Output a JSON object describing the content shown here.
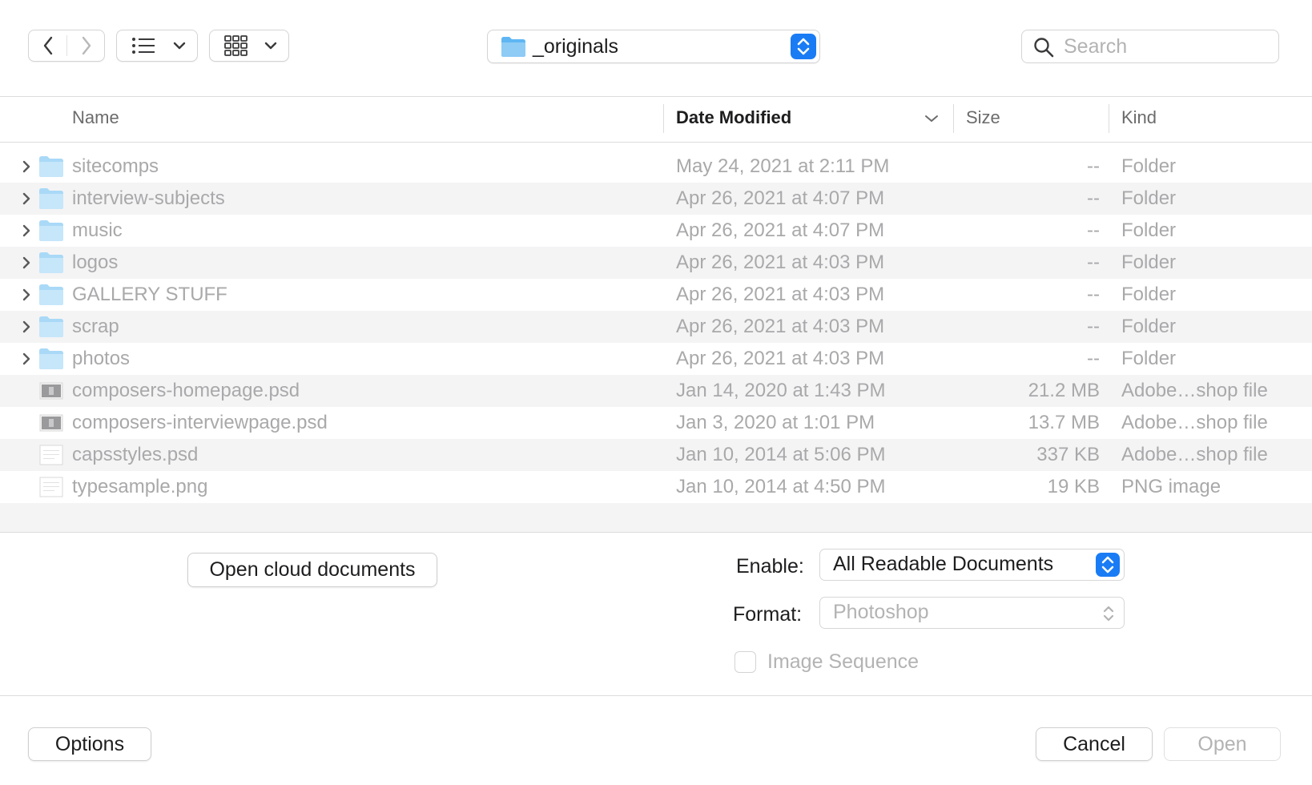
{
  "toolbar": {
    "path_popup_label": "_originals",
    "search_placeholder": "Search"
  },
  "columns": {
    "name": "Name",
    "date": "Date Modified",
    "size": "Size",
    "kind": "Kind"
  },
  "files": [
    {
      "name": "sitecomps",
      "date": "May 24, 2021 at 2:11 PM",
      "size": "--",
      "kind": "Folder",
      "type": "folder"
    },
    {
      "name": "interview-subjects",
      "date": "Apr 26, 2021 at 4:07 PM",
      "size": "--",
      "kind": "Folder",
      "type": "folder"
    },
    {
      "name": "music",
      "date": "Apr 26, 2021 at 4:07 PM",
      "size": "--",
      "kind": "Folder",
      "type": "folder"
    },
    {
      "name": "logos",
      "date": "Apr 26, 2021 at 4:03 PM",
      "size": "--",
      "kind": "Folder",
      "type": "folder"
    },
    {
      "name": "GALLERY STUFF",
      "date": "Apr 26, 2021 at 4:03 PM",
      "size": "--",
      "kind": "Folder",
      "type": "folder"
    },
    {
      "name": "scrap",
      "date": "Apr 26, 2021 at 4:03 PM",
      "size": "--",
      "kind": "Folder",
      "type": "folder"
    },
    {
      "name": "photos",
      "date": "Apr 26, 2021 at 4:03 PM",
      "size": "--",
      "kind": "Folder",
      "type": "folder"
    },
    {
      "name": "composers-homepage.psd",
      "date": "Jan 14, 2020 at 1:43 PM",
      "size": "21.2 MB",
      "kind": "Adobe…shop file",
      "type": "psd-thumb"
    },
    {
      "name": "composers-interviewpage.psd",
      "date": "Jan 3, 2020 at 1:01 PM",
      "size": "13.7 MB",
      "kind": "Adobe…shop file",
      "type": "psd-thumb"
    },
    {
      "name": "capsstyles.psd",
      "date": "Jan 10, 2014 at 5:06 PM",
      "size": "337 KB",
      "kind": "Adobe…shop file",
      "type": "doc"
    },
    {
      "name": "typesample.png",
      "date": "Jan 10, 2014 at 4:50 PM",
      "size": "19 KB",
      "kind": "PNG image",
      "type": "doc"
    }
  ],
  "footer": {
    "cloud_button": "Open cloud documents",
    "enable_label": "Enable:",
    "enable_value": "All Readable Documents",
    "format_label": "Format:",
    "format_value": "Photoshop",
    "image_sequence_label": "Image Sequence",
    "image_sequence_checked": false,
    "options_button": "Options",
    "cancel_button": "Cancel",
    "open_button": "Open"
  },
  "colors": {
    "accent": "#1a7cf5",
    "folder": "#8ecbf5",
    "row_alt": "#f4f4f5",
    "dimmed_text": "#a9a9ab"
  }
}
